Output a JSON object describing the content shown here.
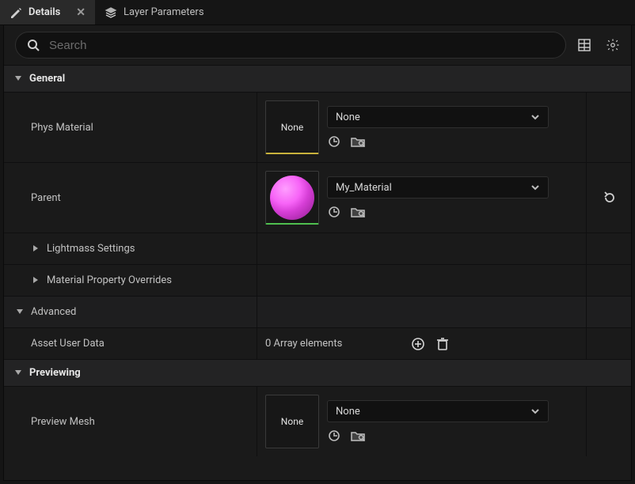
{
  "tabs": {
    "details": "Details",
    "layerParams": "Layer Parameters"
  },
  "search": {
    "placeholder": "Search"
  },
  "categories": {
    "general": "General",
    "advanced": "Advanced",
    "previewing": "Previewing"
  },
  "props": {
    "physMaterial": {
      "label": "Phys Material",
      "thumbText": "None",
      "dropdown": "None"
    },
    "parent": {
      "label": "Parent",
      "dropdown": "My_Material"
    },
    "lightmass": {
      "label": "Lightmass Settings"
    },
    "matOverrides": {
      "label": "Material Property Overrides"
    },
    "assetUserData": {
      "label": "Asset User Data",
      "value": "0 Array elements"
    },
    "previewMesh": {
      "label": "Preview Mesh",
      "thumbText": "None",
      "dropdown": "None"
    }
  }
}
